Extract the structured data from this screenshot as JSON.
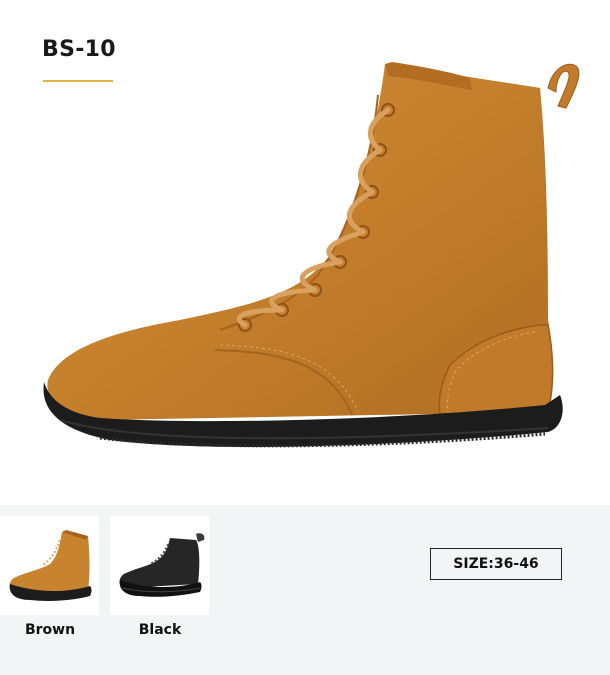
{
  "product": {
    "title": "BS-10",
    "accent_color": "#e3b53a"
  },
  "hero_image": {
    "icon": "brown-leather-lace-up-boot",
    "color": "#c8832f"
  },
  "variants": [
    {
      "label": "Brown",
      "icon": "brown-boot-thumbnail",
      "color": "#c8832f"
    },
    {
      "label": "Black",
      "icon": "black-boot-thumbnail",
      "color": "#222222"
    }
  ],
  "size": {
    "label": "SIZE:36-46"
  }
}
